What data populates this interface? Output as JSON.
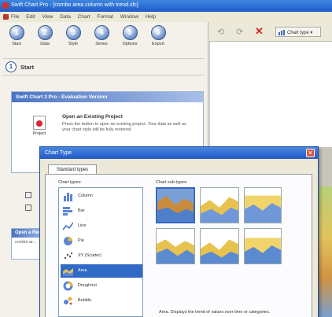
{
  "window": {
    "title": "Swift Chart Pro - [combo area column with trend.sfc]"
  },
  "menu": [
    "File",
    "Edit",
    "View",
    "Data",
    "Chart",
    "Format",
    "Window",
    "Help"
  ],
  "toolbar": {
    "buttons": [
      {
        "label": "Start",
        "number": "1"
      },
      {
        "label": "Data",
        "number": "2"
      },
      {
        "label": "Style",
        "number": "3"
      },
      {
        "label": "Series",
        "number": "4"
      },
      {
        "label": "Options",
        "number": "5"
      },
      {
        "label": "Export",
        "number": "6"
      }
    ]
  },
  "start_section": {
    "number": "1",
    "label": "Start"
  },
  "eval_panel": {
    "title": "Swift Chart 3 Pro - Evaluation Version",
    "project_label": "Project",
    "open_title": "Open an Existing Project",
    "open_desc": "Press the button to open an existing project. Your data as well as your chart style will be fully restored."
  },
  "open_recent": {
    "title": "Open a Recent",
    "item": "combo ar..."
  },
  "right_toolbar": {
    "chart_type_label": "Chart type"
  },
  "dialog": {
    "title": "Chart Type",
    "tab": "Standard types",
    "chart_types_label": "Chart types:",
    "chart_subtypes_label": "Chart sub-types:",
    "types": [
      "Column",
      "Bar",
      "Line",
      "Pie",
      "XY (Scatter)",
      "Area",
      "Doughnut",
      "Bubble"
    ],
    "selected_type": "Area",
    "description": "Area. Displays the trend of values over time or categories."
  }
}
